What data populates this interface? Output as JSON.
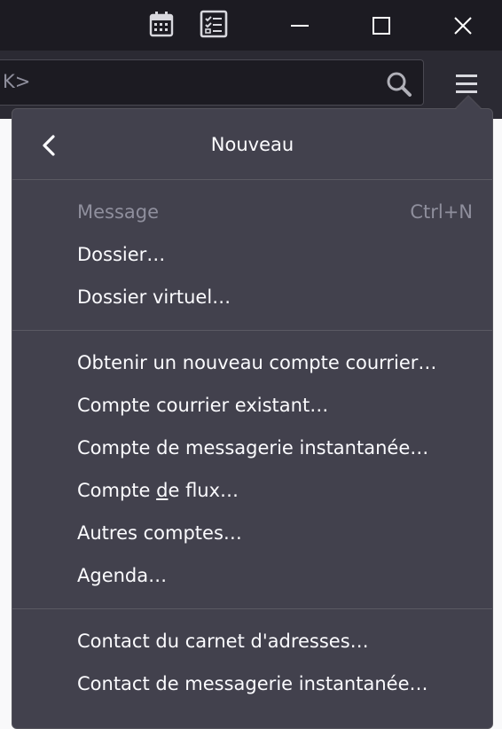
{
  "titlebar": {
    "icons": [
      "calendar-icon",
      "tasks-icon",
      "minimize-icon",
      "maximize-icon",
      "close-icon"
    ]
  },
  "search": {
    "value": "K>"
  },
  "menu": {
    "title": "Nouveau",
    "group1": [
      {
        "label": "Message",
        "shortcut": "Ctrl+N",
        "disabled": true
      },
      {
        "label": "Dossier…"
      },
      {
        "label": "Dossier virtuel…"
      }
    ],
    "group2": [
      {
        "label": "Obtenir un nouveau compte courrier…"
      },
      {
        "label": "Compte courrier existant…"
      },
      {
        "label": "Compte de messagerie instantanée…"
      },
      {
        "label_pre": "Compte ",
        "label_accel": "d",
        "label_post": "e flux…"
      },
      {
        "label": "Autres comptes…"
      },
      {
        "label": "Agenda…"
      }
    ],
    "group3": [
      {
        "label": "Contact du carnet d'adresses…"
      },
      {
        "label": "Contact de messagerie instantanée…"
      }
    ]
  },
  "colors": {
    "titlebar_bg": "#1c1b22",
    "toolbar_bg": "#2b2a33",
    "panel_bg": "#42414d",
    "text": "#fbfbfe",
    "disabled_text": "#8f8f9d"
  }
}
